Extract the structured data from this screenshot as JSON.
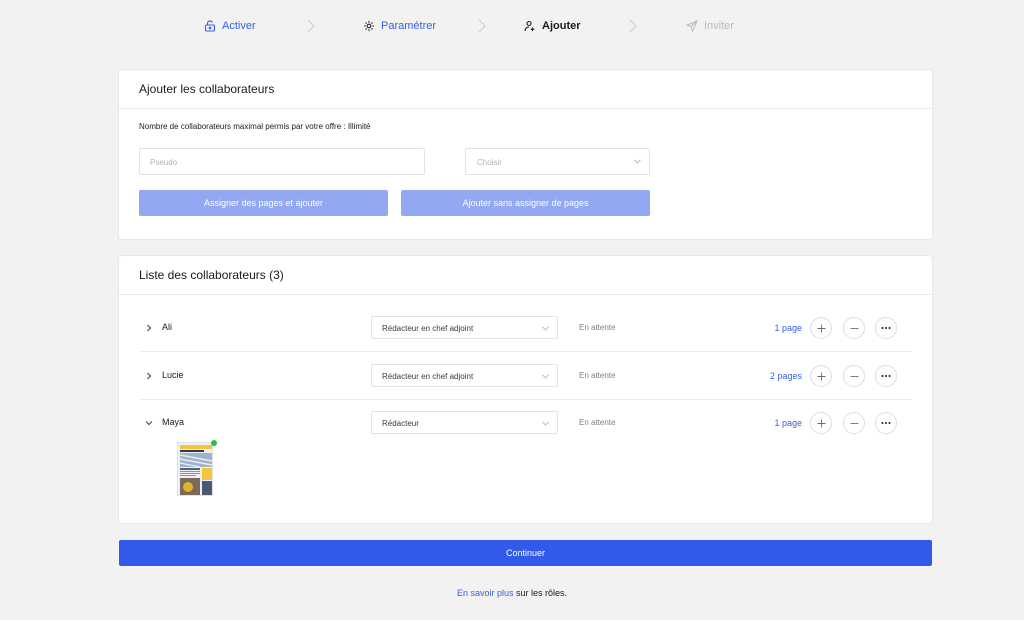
{
  "stepper": {
    "steps": [
      {
        "label": "Activer",
        "icon": "lock-open-icon",
        "state": "done"
      },
      {
        "label": "Paramétrer",
        "icon": "gear-icon",
        "state": "done"
      },
      {
        "label": "Ajouter",
        "icon": "add-user-icon",
        "state": "current"
      },
      {
        "label": "Inviter",
        "icon": "paper-plane-icon",
        "state": "disabled"
      }
    ]
  },
  "add_card": {
    "title": "Ajouter les collaborateurs",
    "max_info": "Nombre de collaborateurs maximal permis par votre offre : Illimité",
    "pseudo_placeholder": "Pseudo",
    "role_placeholder": "Choisir",
    "assign_button": "Assigner des pages et ajouter",
    "add_button": "Ajouter sans assigner de pages"
  },
  "list_card": {
    "title": "Liste des collaborateurs (3)",
    "rows": [
      {
        "name": "Ali",
        "role": "Rédacteur en chef adjoint",
        "status": "En attente",
        "pages": "1 page",
        "expanded": false
      },
      {
        "name": "Lucie",
        "role": "Rédacteur en chef adjoint",
        "status": "En attente",
        "pages": "2 pages",
        "expanded": false
      },
      {
        "name": "Maya",
        "role": "Rédacteur",
        "status": "En attente",
        "pages": "1 page",
        "expanded": true
      }
    ]
  },
  "continue_button": "Continuer",
  "footer": {
    "link": "En savoir plus",
    "text": " sur les rôles."
  },
  "colors": {
    "accent": "#3359e8",
    "accent_light": "#93a8f2",
    "status_online": "#2dbd4a"
  }
}
